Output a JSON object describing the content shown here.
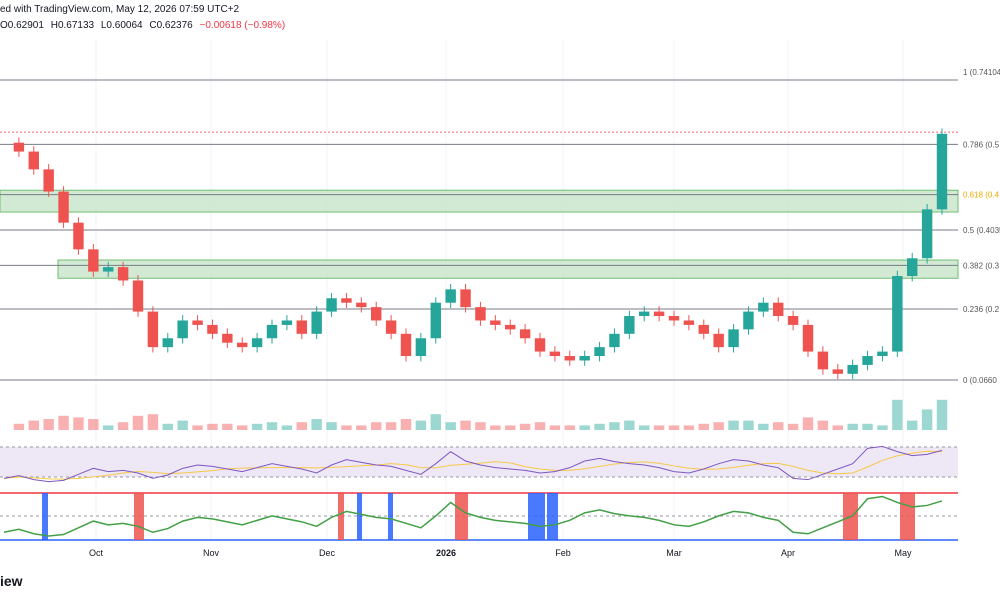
{
  "header": {
    "published": "ed with TradingView.com, May 12, 2026 07:59 UTC+2",
    "ohlc": {
      "open": "O0.62901",
      "high": "H0.67133",
      "low": "L0.60064",
      "close": "C0.62376",
      "change": "−0.00618 (−0.98%)"
    }
  },
  "brand": "iew",
  "colors": {
    "up": "#26a69a",
    "down": "#ef5350",
    "fib_line": "#787b86",
    "zone_fill": "#c8e6c9",
    "zone_stroke": "#4caf50",
    "rsi_line": "#7e57c2",
    "rsi_ma": "#f7c948",
    "rsi_band": "#ede7f6",
    "osc_top": "#f23645",
    "osc_bottom": "#2962ff",
    "fib618": "#f2a900",
    "price_line": "#f23645"
  },
  "chart_data": {
    "type": "candlestick",
    "y_axis_side": "right",
    "fib_levels": [
      {
        "ratio": 1,
        "label": "1 (0.74104",
        "price": 0.74104
      },
      {
        "ratio": 0.786,
        "label": "0.786 (0.5",
        "price": 0.5963
      },
      {
        "ratio": 0.618,
        "label": "0.618 (0.4",
        "price": 0.4832
      },
      {
        "ratio": 0.5,
        "label": "0.5 (0.4035",
        "price": 0.4035
      },
      {
        "ratio": 0.382,
        "label": "0.382 (0.3",
        "price": 0.3239
      },
      {
        "ratio": 0.236,
        "label": "0.236 (0.2",
        "price": 0.2257
      },
      {
        "ratio": 0,
        "label": "0 (0.0660",
        "price": 0.06607
      }
    ],
    "zones": [
      {
        "from": 0.444,
        "to": 0.493
      },
      {
        "from": 0.295,
        "to": 0.336
      }
    ],
    "x_labels": [
      "Oct",
      "Nov",
      "Dec",
      "2026",
      "Feb",
      "Mar",
      "Apr",
      "May"
    ],
    "current_price": 0.62376,
    "series": {
      "price_path": [
        0.6,
        0.58,
        0.54,
        0.49,
        0.42,
        0.36,
        0.31,
        0.32,
        0.29,
        0.22,
        0.14,
        0.16,
        0.2,
        0.19,
        0.17,
        0.15,
        0.14,
        0.16,
        0.19,
        0.2,
        0.17,
        0.22,
        0.25,
        0.24,
        0.23,
        0.2,
        0.17,
        0.12,
        0.16,
        0.24,
        0.27,
        0.23,
        0.2,
        0.19,
        0.18,
        0.16,
        0.13,
        0.12,
        0.11,
        0.12,
        0.14,
        0.17,
        0.21,
        0.22,
        0.21,
        0.2,
        0.19,
        0.17,
        0.14,
        0.18,
        0.22,
        0.24,
        0.21,
        0.19,
        0.13,
        0.09,
        0.08,
        0.1,
        0.12,
        0.13,
        0.3,
        0.34,
        0.45,
        0.62
      ],
      "rsi": [
        30,
        34,
        28,
        25,
        27,
        36,
        45,
        40,
        42,
        38,
        30,
        35,
        45,
        50,
        48,
        44,
        40,
        46,
        52,
        48,
        44,
        38,
        50,
        58,
        54,
        50,
        48,
        42,
        36,
        52,
        70,
        56,
        50,
        46,
        44,
        42,
        38,
        40,
        46,
        56,
        60,
        55,
        52,
        50,
        46,
        40,
        38,
        44,
        52,
        58,
        56,
        50,
        46,
        30,
        28,
        36,
        44,
        52,
        75,
        78,
        70,
        64,
        66,
        72
      ]
    },
    "panels": {
      "volume_spike_note": "",
      "rsi_bounds": [
        30,
        70
      ],
      "osc_bounds": [
        0,
        100
      ]
    }
  }
}
